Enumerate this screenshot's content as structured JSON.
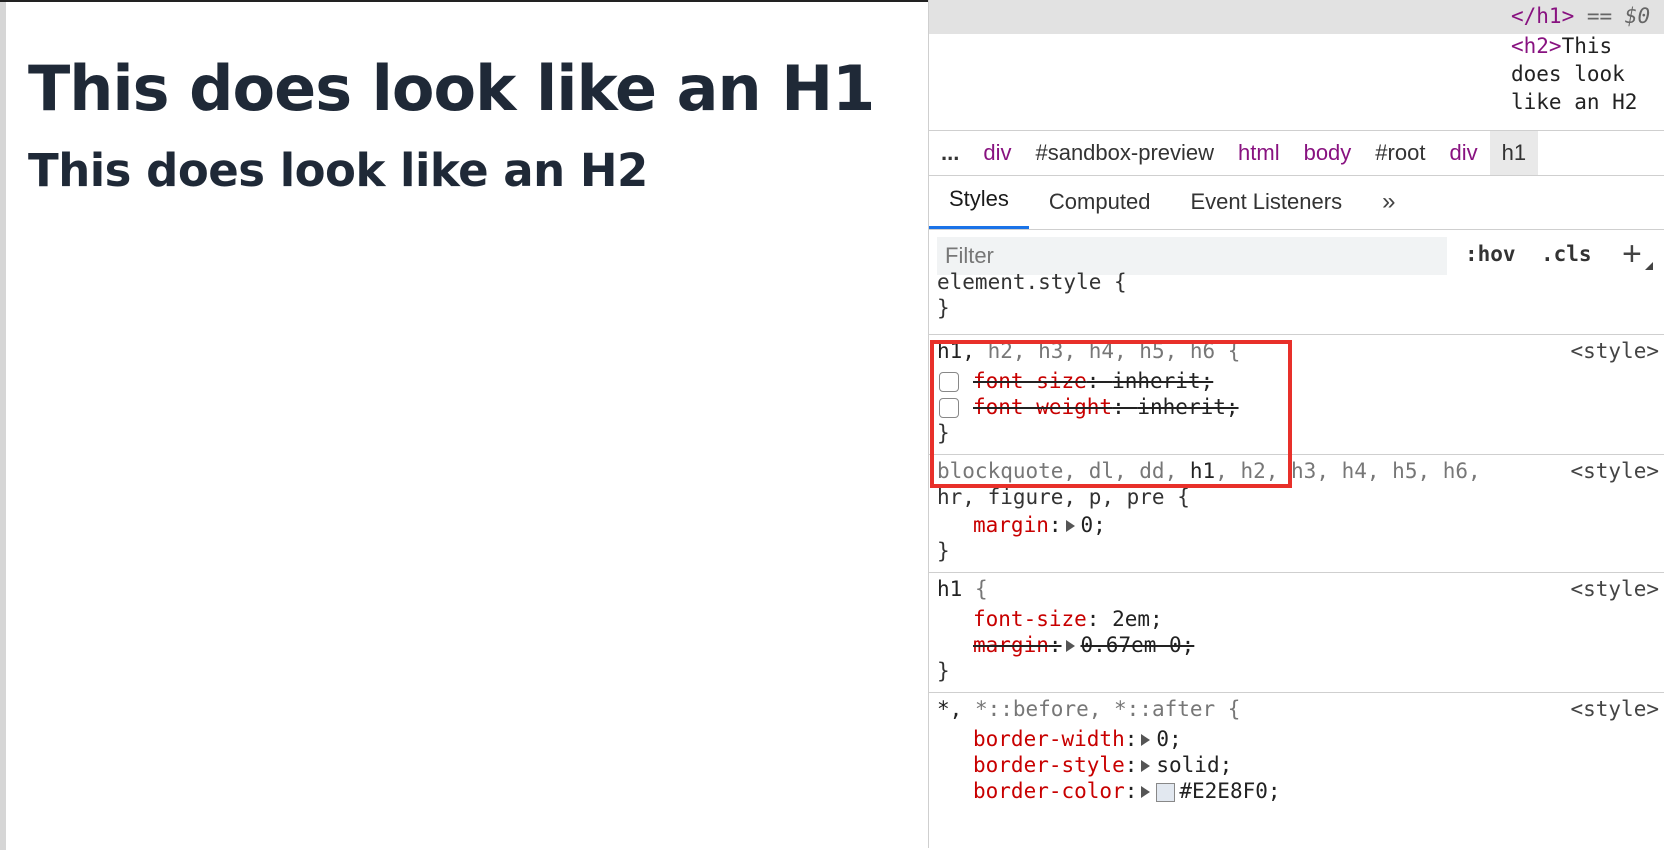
{
  "preview": {
    "h1_text": "This does look like an H1",
    "h2_text": "This does look like an H2"
  },
  "elements": {
    "close_h1_tag": "</h1>",
    "dollar_marker": "== $0",
    "h2_open_tag": "<h2>",
    "h2_text_line1": "This",
    "h2_text_line2": "does look",
    "h2_text_line3": "like an H2"
  },
  "breadcrumb": {
    "items": [
      "...",
      "div",
      "#sandbox-preview",
      "html",
      "body",
      "#root",
      "div",
      "h1"
    ]
  },
  "tabs": {
    "items": [
      "Styles",
      "Computed",
      "Event Listeners"
    ],
    "more": "»"
  },
  "filter": {
    "placeholder": "Filter",
    "hov": ":hov",
    "cls": ".cls",
    "add": "+"
  },
  "rules": {
    "element_style": {
      "selector": "element.style {",
      "close": "}"
    },
    "headings_reset": {
      "selector_match": "h1,",
      "selector_rest": " h2, h3, h4, h5, h6 {",
      "source": "<style>",
      "props": [
        {
          "name": "font-size",
          "value": "inherit;"
        },
        {
          "name": "font-weight",
          "value": "inherit;"
        }
      ],
      "close": "}"
    },
    "block_reset": {
      "selector_part1": "blockquote, dl, dd, ",
      "selector_match": "h1",
      "selector_part2": ", h2, h3, h4, h5, h6,",
      "selector_line2": "hr, figure, p, pre {",
      "source": "<style>",
      "prop": "margin",
      "value": "0;",
      "close": "}"
    },
    "h1_rule": {
      "selector_match": "h1",
      "selector_rest": " {",
      "source": "<style>",
      "prop1": "font-size",
      "value1": "2em;",
      "prop2": "margin",
      "value2": "0.67em 0;",
      "close": "}"
    },
    "universal": {
      "selector_match": "*,",
      "selector_rest": " *::before, *::after {",
      "source": "<style>",
      "prop1": "border-width",
      "value1": "0;",
      "prop2": "border-style",
      "value2": "solid;",
      "prop3": "border-color",
      "value3": "#E2E8F0;"
    }
  },
  "colors": {
    "highlight_box": "#e8302a",
    "css_property": "#c80000",
    "dom_tag": "#881280",
    "active_tab_underline": "#1a73e8",
    "heading_text": "#1f2937",
    "swatch": "#E2E8F0"
  }
}
